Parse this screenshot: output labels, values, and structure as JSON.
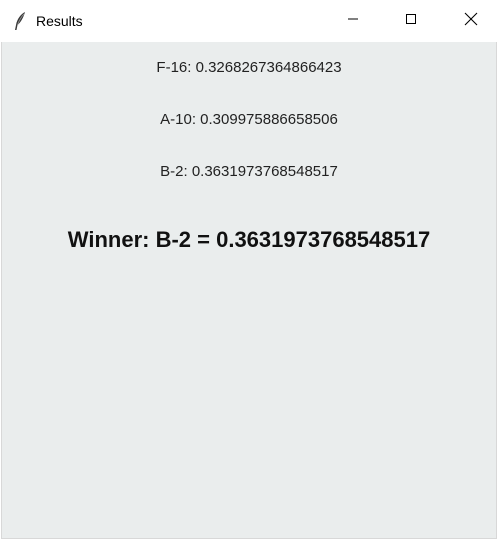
{
  "window": {
    "title": "Results",
    "icon": "feather-icon"
  },
  "controls": {
    "minimize": "minimize-icon",
    "maximize": "maximize-icon",
    "close": "close-icon"
  },
  "results": [
    {
      "text": "F-16: 0.3268267364866423"
    },
    {
      "text": "A-10: 0.309975886658506"
    },
    {
      "text": "B-2: 0.3631973768548517"
    }
  ],
  "winner": {
    "text": "Winner: B-2 = 0.3631973768548517"
  },
  "colors": {
    "client_background": "#eaeded",
    "titlebar_background": "#ffffff"
  }
}
